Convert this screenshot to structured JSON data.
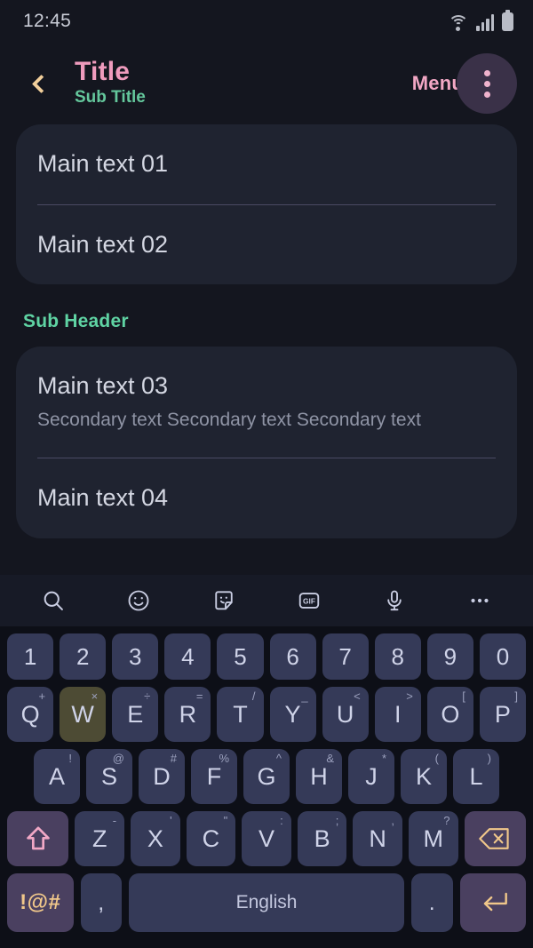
{
  "status_bar": {
    "time": "12:45",
    "icons": [
      "wifi-icon",
      "cellular-signal-icon",
      "battery-icon"
    ]
  },
  "app_bar": {
    "back_icon": "back-chevron-icon",
    "title": "Title",
    "subtitle": "Sub Title",
    "menu_label": "Menu",
    "overflow_icon": "overflow-menu-icon",
    "colors": {
      "title": "#ef9bbd",
      "subtitle": "#64c79c",
      "back_chevron": "#f2cf9b",
      "menu_label": "#f2a7c4",
      "overflow_circle": "#3a3148"
    }
  },
  "content": {
    "card_one": {
      "rows": [
        {
          "main": "Main text 01"
        },
        {
          "main": "Main text 02"
        }
      ]
    },
    "sub_header": "Sub Header",
    "card_two": {
      "rows": [
        {
          "main": "Main text 03",
          "secondary": "Secondary text Secondary text Secondary text"
        },
        {
          "main": "Main text 04"
        }
      ]
    },
    "colors": {
      "card_background": "#1f2330",
      "page_background": "#14161f",
      "main_text": "#d4d7e2",
      "secondary_text": "#8f94a5",
      "divider": "#4a4a63",
      "sub_header": "#5fd3a3"
    }
  },
  "keyboard": {
    "toolbar": [
      {
        "name": "search-icon",
        "label": ""
      },
      {
        "name": "emoji-icon",
        "label": ""
      },
      {
        "name": "sticker-icon",
        "label": ""
      },
      {
        "name": "gif-icon",
        "label": "GIF"
      },
      {
        "name": "microphone-icon",
        "label": ""
      },
      {
        "name": "more-options-icon",
        "label": ""
      }
    ],
    "rows": {
      "numbers": [
        {
          "key": "1"
        },
        {
          "key": "2"
        },
        {
          "key": "3"
        },
        {
          "key": "4"
        },
        {
          "key": "5"
        },
        {
          "key": "6"
        },
        {
          "key": "7"
        },
        {
          "key": "8"
        },
        {
          "key": "9"
        },
        {
          "key": "0"
        }
      ],
      "top": [
        {
          "key": "Q",
          "sup": "+"
        },
        {
          "key": "W",
          "sup": "×",
          "pressed": true
        },
        {
          "key": "E",
          "sup": "÷"
        },
        {
          "key": "R",
          "sup": "="
        },
        {
          "key": "T",
          "sup": "/"
        },
        {
          "key": "Y",
          "sup": "_"
        },
        {
          "key": "U",
          "sup": "<"
        },
        {
          "key": "I",
          "sup": ">"
        },
        {
          "key": "O",
          "sup": "["
        },
        {
          "key": "P",
          "sup": "]"
        }
      ],
      "home": [
        {
          "key": "A",
          "sup": "!"
        },
        {
          "key": "S",
          "sup": "@"
        },
        {
          "key": "D",
          "sup": "#"
        },
        {
          "key": "F",
          "sup": "%"
        },
        {
          "key": "G",
          "sup": "^"
        },
        {
          "key": "H",
          "sup": "&"
        },
        {
          "key": "J",
          "sup": "*"
        },
        {
          "key": "K",
          "sup": "("
        },
        {
          "key": "L",
          "sup": ")"
        }
      ],
      "bottom_letters": [
        {
          "key": "Z",
          "sup": "-"
        },
        {
          "key": "X",
          "sup": "'"
        },
        {
          "key": "C",
          "sup": "\""
        },
        {
          "key": "V",
          "sup": ":"
        },
        {
          "key": "B",
          "sup": ";"
        },
        {
          "key": "N",
          "sup": ","
        },
        {
          "key": "M",
          "sup": "?"
        }
      ],
      "shift_icon": "shift-arrow-icon",
      "backspace_icon": "backspace-icon",
      "symbols_key": "!@#",
      "comma_key": ",",
      "space_key": "English",
      "period_key": ".",
      "enter_icon": "enter-return-icon"
    },
    "colors": {
      "background": "#0d0f17",
      "toolbar_background": "#171a26",
      "key": "#353a58",
      "key_pressed": "#4d4b34",
      "key_accent": "#4a4060",
      "key_text": "#cfd3e8",
      "shift_arrow": "#f1a8c6",
      "gold_glyph": "#f0c78a"
    }
  }
}
